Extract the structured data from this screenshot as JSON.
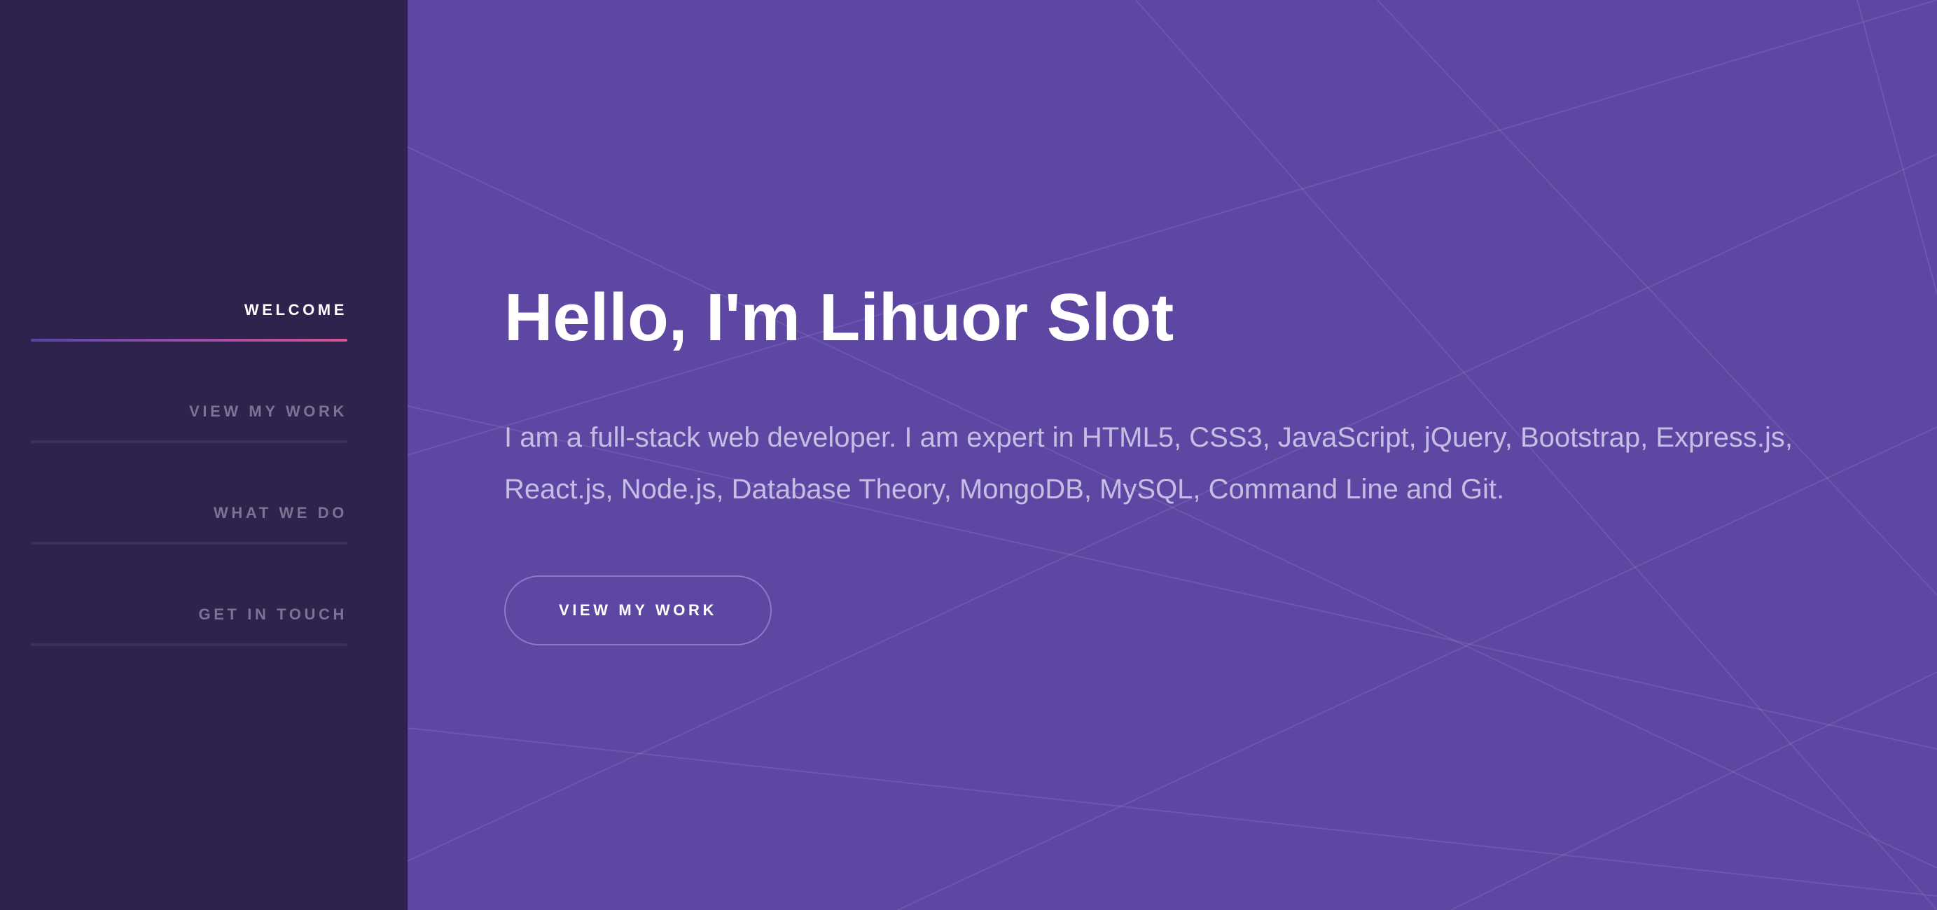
{
  "colors": {
    "background": "#5d47a3",
    "sidebar": "#2f234e",
    "nav_inactive": "#7c7291",
    "nav_active": "#ffffff",
    "accent_gradient_start": "#5546a8",
    "accent_gradient_end": "#d4548f",
    "description": "#c6bde2"
  },
  "sidebar": {
    "items": [
      {
        "label": "WELCOME",
        "active": true
      },
      {
        "label": "VIEW MY WORK",
        "active": false
      },
      {
        "label": "WHAT WE DO",
        "active": false
      },
      {
        "label": "GET IN TOUCH",
        "active": false
      }
    ]
  },
  "hero": {
    "title": "Hello, I'm Lihuor Slot",
    "description": "I am a full-stack web developer. I am expert in HTML5, CSS3, JavaScript, jQuery, Bootstrap, Express.js, React.js, Node.js, Database Theory, MongoDB, MySQL, Command Line and Git.",
    "cta_label": "VIEW MY WORK"
  }
}
